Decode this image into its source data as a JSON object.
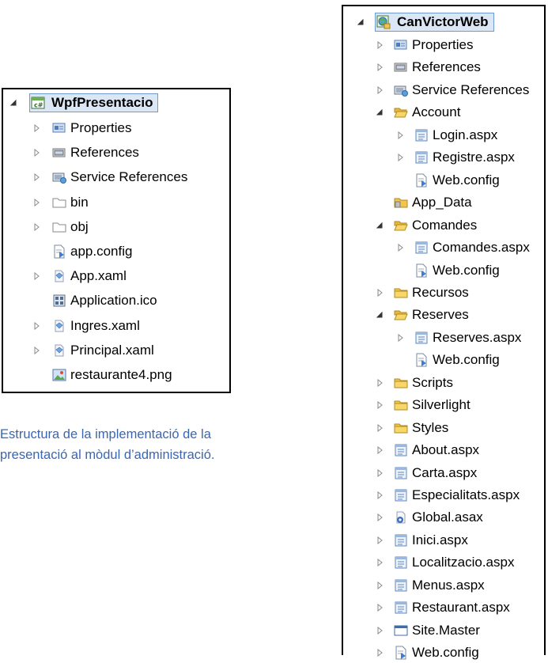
{
  "left_tree": {
    "root": {
      "label": "WpfPresentacio",
      "icon": "csharp-project-icon",
      "expanded": true
    },
    "items": [
      {
        "label": "Properties",
        "icon": "properties-icon",
        "expander": "collapsed"
      },
      {
        "label": "References",
        "icon": "references-icon",
        "expander": "collapsed"
      },
      {
        "label": "Service References",
        "icon": "service-references-icon",
        "expander": "collapsed"
      },
      {
        "label": "bin",
        "icon": "folder-outline-icon",
        "expander": "collapsed"
      },
      {
        "label": "obj",
        "icon": "folder-outline-icon",
        "expander": "collapsed"
      },
      {
        "label": "app.config",
        "icon": "config-file-icon",
        "expander": "none"
      },
      {
        "label": "App.xaml",
        "icon": "xaml-file-icon",
        "expander": "collapsed"
      },
      {
        "label": "Application.ico",
        "icon": "ico-file-icon",
        "expander": "none"
      },
      {
        "label": "Ingres.xaml",
        "icon": "xaml-file-icon",
        "expander": "collapsed"
      },
      {
        "label": "Principal.xaml",
        "icon": "xaml-file-icon",
        "expander": "collapsed"
      },
      {
        "label": "restaurante4.png",
        "icon": "image-file-icon",
        "expander": "none"
      }
    ]
  },
  "caption": {
    "line1": "Estructura de la implementació de la",
    "line2": "presentació al mòdul d’administració."
  },
  "right_tree": {
    "root": {
      "label": "CanVictorWeb",
      "icon": "web-project-icon",
      "expanded": true
    },
    "items": [
      {
        "label": "Properties",
        "icon": "properties-icon",
        "expander": "collapsed",
        "level": 1
      },
      {
        "label": "References",
        "icon": "references-icon",
        "expander": "collapsed",
        "level": 1
      },
      {
        "label": "Service References",
        "icon": "service-references-icon",
        "expander": "collapsed",
        "level": 1
      },
      {
        "label": "Account",
        "icon": "folder-open-icon",
        "expander": "expanded",
        "level": 1
      },
      {
        "label": "Login.aspx",
        "icon": "aspx-file-icon",
        "expander": "collapsed",
        "level": 2
      },
      {
        "label": "Registre.aspx",
        "icon": "aspx-file-icon",
        "expander": "collapsed",
        "level": 2
      },
      {
        "label": "Web.config",
        "icon": "config-file-icon",
        "expander": "none",
        "level": 2
      },
      {
        "label": "App_Data",
        "icon": "app-data-folder-icon",
        "expander": "none",
        "level": 1
      },
      {
        "label": "Comandes",
        "icon": "folder-open-icon",
        "expander": "expanded",
        "level": 1
      },
      {
        "label": "Comandes.aspx",
        "icon": "aspx-file-icon",
        "expander": "collapsed",
        "level": 2
      },
      {
        "label": "Web.config",
        "icon": "config-file-icon",
        "expander": "none",
        "level": 2
      },
      {
        "label": "Recursos",
        "icon": "folder-closed-icon",
        "expander": "collapsed",
        "level": 1
      },
      {
        "label": "Reserves",
        "icon": "folder-open-icon",
        "expander": "expanded",
        "level": 1
      },
      {
        "label": "Reserves.aspx",
        "icon": "aspx-file-icon",
        "expander": "collapsed",
        "level": 2
      },
      {
        "label": "Web.config",
        "icon": "config-file-icon",
        "expander": "none",
        "level": 2
      },
      {
        "label": "Scripts",
        "icon": "folder-closed-icon",
        "expander": "collapsed",
        "level": 1
      },
      {
        "label": "Silverlight",
        "icon": "folder-closed-icon",
        "expander": "collapsed",
        "level": 1
      },
      {
        "label": "Styles",
        "icon": "folder-closed-icon",
        "expander": "collapsed",
        "level": 1
      },
      {
        "label": "About.aspx",
        "icon": "aspx-file-icon",
        "expander": "collapsed",
        "level": 1
      },
      {
        "label": "Carta.aspx",
        "icon": "aspx-file-icon",
        "expander": "collapsed",
        "level": 1
      },
      {
        "label": "Especialitats.aspx",
        "icon": "aspx-file-icon",
        "expander": "collapsed",
        "level": 1
      },
      {
        "label": "Global.asax",
        "icon": "global-asax-icon",
        "expander": "collapsed",
        "level": 1
      },
      {
        "label": "Inici.aspx",
        "icon": "aspx-file-icon",
        "expander": "collapsed",
        "level": 1
      },
      {
        "label": "Localitzacio.aspx",
        "icon": "aspx-file-icon",
        "expander": "collapsed",
        "level": 1
      },
      {
        "label": "Menus.aspx",
        "icon": "aspx-file-icon",
        "expander": "collapsed",
        "level": 1
      },
      {
        "label": "Restaurant.aspx",
        "icon": "aspx-file-icon",
        "expander": "collapsed",
        "level": 1
      },
      {
        "label": "Site.Master",
        "icon": "master-page-icon",
        "expander": "collapsed",
        "level": 1
      },
      {
        "label": "Web.config",
        "icon": "config-file-icon",
        "expander": "collapsed",
        "level": 1
      }
    ]
  },
  "colors": {
    "caption_text": "#3b66b0",
    "root_highlight": "#dce7f5",
    "folder_yellow": "#f3c54b",
    "aspx_blue": "#5b86c2"
  }
}
